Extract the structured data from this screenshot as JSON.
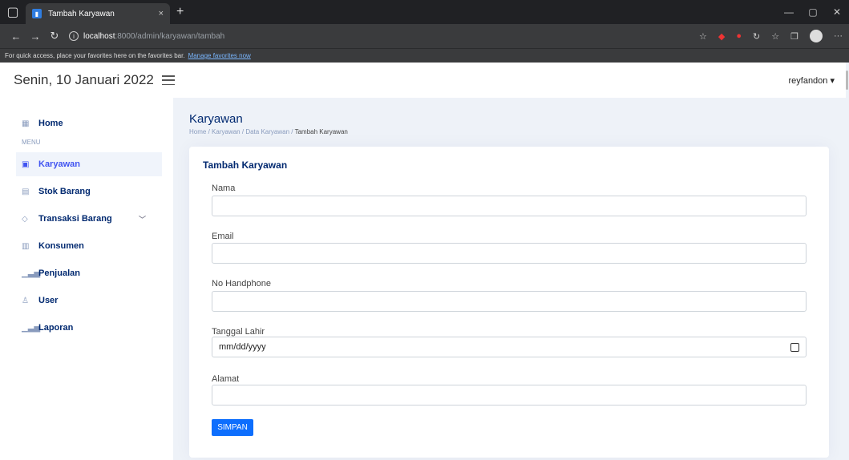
{
  "browser": {
    "tab_title": "Tambah Karyawan",
    "tab_close": "×",
    "new_tab": "+",
    "url_host": "localhost",
    "url_path": ":8000/admin/karyawan/tambah",
    "favorites_text": "For quick access, place your favorites here on the favorites bar.",
    "favorites_link": "Manage favorites now"
  },
  "header": {
    "date": "Senin, 10 Januari 2022",
    "user": "reyfandon ▾"
  },
  "sidebar": {
    "home": "Home",
    "menu_label": "MENU",
    "items": [
      {
        "label": "Karyawan",
        "icon": "document-icon"
      },
      {
        "label": "Stok Barang",
        "icon": "card-icon"
      },
      {
        "label": "Transaksi Barang",
        "icon": "gem-icon"
      },
      {
        "label": "Konsumen",
        "icon": "table-icon"
      },
      {
        "label": "Penjualan",
        "icon": "bar-chart-icon"
      },
      {
        "label": "User",
        "icon": "person-icon"
      },
      {
        "label": "Laporan",
        "icon": "bar-chart-icon"
      }
    ]
  },
  "page": {
    "title": "Karyawan",
    "breadcrumb": [
      "Home",
      "Karyawan",
      "Data Karyawan",
      "Tambah Karyawan"
    ],
    "breadcrumb_sep": "/"
  },
  "form": {
    "title": "Tambah Karyawan",
    "fields": [
      {
        "label": "Nama",
        "value": ""
      },
      {
        "label": "Email",
        "value": ""
      },
      {
        "label": "No Handphone",
        "value": ""
      },
      {
        "label": "Tanggal Lahir",
        "value": "mm/dd/yyyy"
      },
      {
        "label": "Alamat",
        "value": ""
      }
    ],
    "submit_label": "SIMPAN"
  },
  "colors": {
    "primary": "#4154f1",
    "button": "#0d6efd",
    "heading": "#012970"
  }
}
